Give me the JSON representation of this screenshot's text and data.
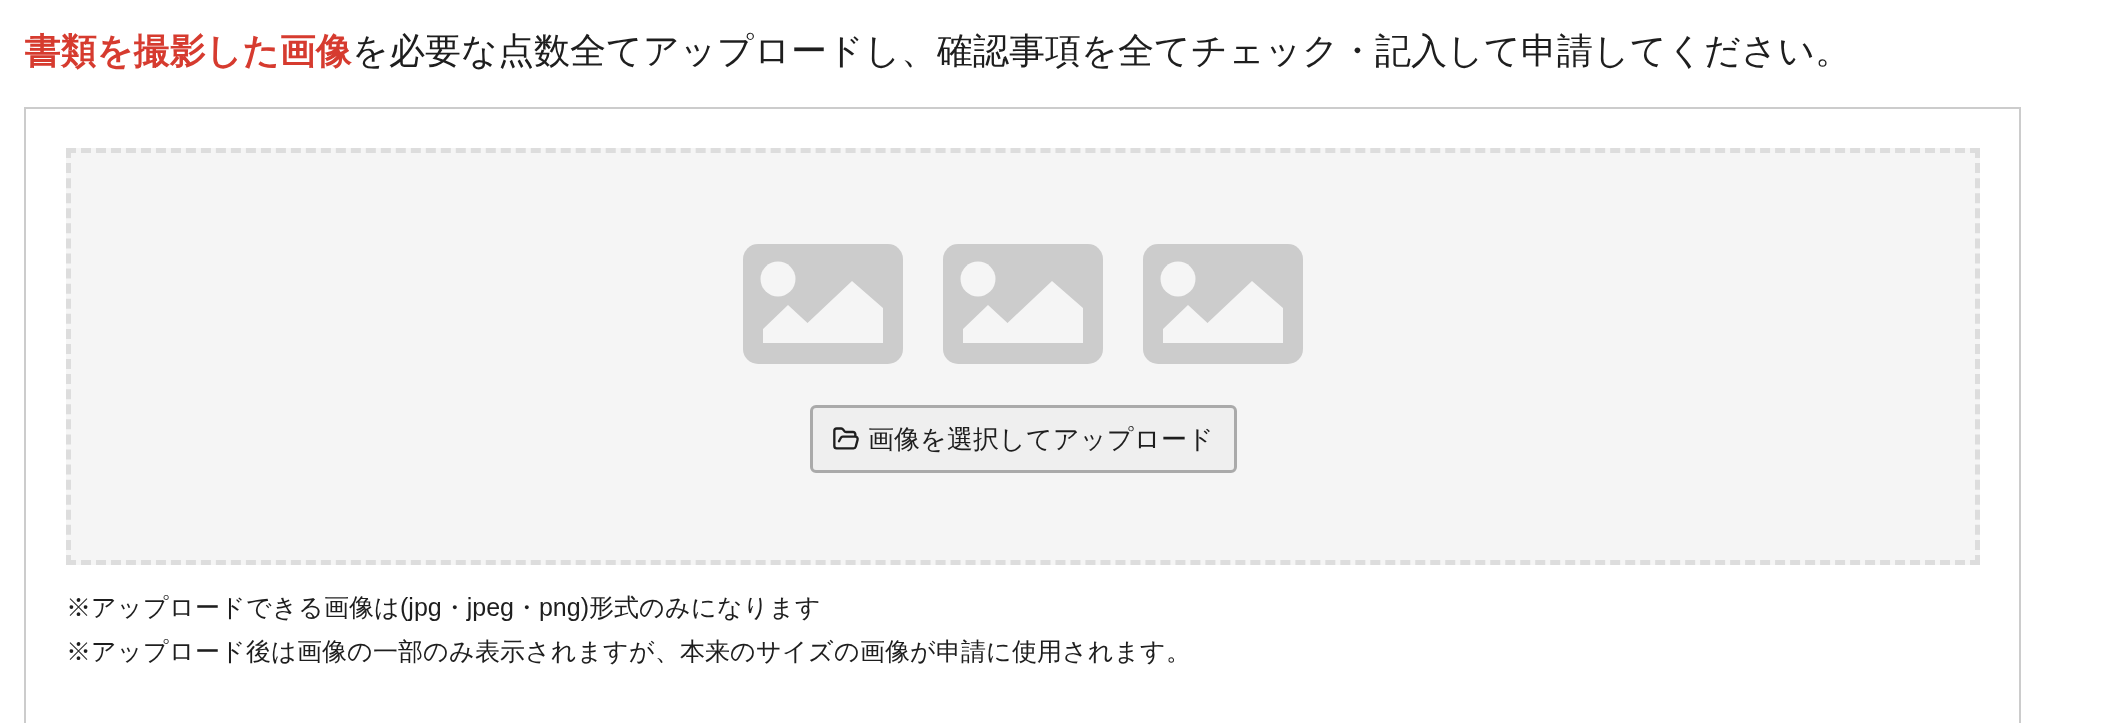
{
  "heading": "**書類を撮影した画像**を必要な点数全てアップロードし、確認事項を全てチェック・記入して申請してください。",
  "upload_area": {
    "image_slots": [
      {
        "kind": "placeholder"
      },
      {
        "kind": "placeholder"
      },
      {
        "kind": "placeholder"
      }
    ],
    "button": "画像を選択してアップロード"
  },
  "notes": [
    "※アップロードできる画像は(jpg・jpeg・png)形式のみになります",
    "※アップロード後は画像の一部のみ表示されますが、本来のサイズの画像が申請に使用されます。"
  ]
}
